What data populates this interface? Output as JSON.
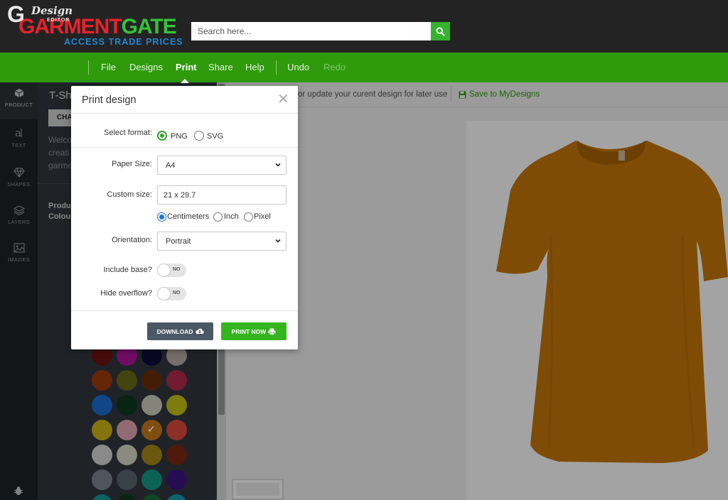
{
  "header": {
    "logo_part1": "GARMENT",
    "logo_part2": "GATE",
    "logo_tagline": "ACCESS TRADE PRICES",
    "search_placeholder": "Search here...",
    "search_icon": "magnifier-icon"
  },
  "navbar": {
    "logo_letter": "G",
    "logo_word": "Design",
    "logo_sub": "EDITOR",
    "items": [
      {
        "label": "File",
        "state": "normal"
      },
      {
        "label": "Designs",
        "state": "normal"
      },
      {
        "label": "Print",
        "state": "active"
      },
      {
        "label": "Share",
        "state": "normal"
      },
      {
        "label": "Help",
        "state": "normal"
      },
      {
        "label": "Undo",
        "state": "normal"
      },
      {
        "label": "Redo",
        "state": "disabled"
      }
    ]
  },
  "sidebar": {
    "items": [
      {
        "label": "PRODUCT",
        "icon": "cube-icon",
        "active": true
      },
      {
        "label": "TEXT",
        "icon": "text-icon",
        "active": false
      },
      {
        "label": "SHAPES",
        "icon": "diamond-icon",
        "active": false
      },
      {
        "label": "LAYERS",
        "icon": "layers-icon",
        "active": false
      },
      {
        "label": "IMAGES",
        "icon": "image-icon",
        "active": false
      }
    ],
    "bottom_icon": "bug-icon"
  },
  "product_panel": {
    "title": "T-Shi",
    "change_label": "CHA",
    "description": "Welco creati garme",
    "product_label": "Produc",
    "colour_label": "Colour",
    "swatches": [
      [
        "#6e1212",
        "#b0159c",
        "#0e0e3a",
        "#b8aca8"
      ],
      [
        "#a03a0c",
        "#6b6b17",
        "#6b2e0c",
        "#b52b4b"
      ],
      [
        "#1a6fd6",
        "#0e3a1f",
        "#cfcfc0",
        "#c7c217"
      ],
      [
        "#d1b414",
        "#e5a7b3",
        "#c97b18",
        "#dc4a3a"
      ],
      [
        "#d8d8d8",
        "#d8d8c8",
        "#a88818",
        "#7a2a14"
      ],
      [
        "#7b8590",
        "#5a6670",
        "#159a8a",
        "#3d1480"
      ]
    ],
    "selected_swatch": "#c97b18"
  },
  "main": {
    "toolbar_text": "or update your curent design for later use",
    "save_label": "Save to MyDesigns",
    "save_icon": "floppy-disk-icon",
    "tshirt_color": "#c77708"
  },
  "modal": {
    "title": "Print design",
    "close_icon": "close-icon",
    "format_label": "Select format:",
    "formats": [
      "PNG",
      "SVG"
    ],
    "selected_format": "PNG",
    "paper_size_label": "Paper Size:",
    "paper_size_value": "A4",
    "custom_size_label": "Custom size:",
    "custom_size_value": "21 x 29.7",
    "units": [
      "Centimeters",
      "Inch",
      "Pixel"
    ],
    "selected_unit": "Centimeters",
    "orientation_label": "Orientation:",
    "orientation_value": "Portrait",
    "include_base_label": "Include base?",
    "include_base_value": "NO",
    "hide_overflow_label": "Hide overflow?",
    "hide_overflow_value": "NO",
    "download_label": "DOWNLOAD",
    "download_icon": "cloud-download-icon",
    "print_label": "PRINT NOW",
    "print_icon": "printer-icon"
  }
}
